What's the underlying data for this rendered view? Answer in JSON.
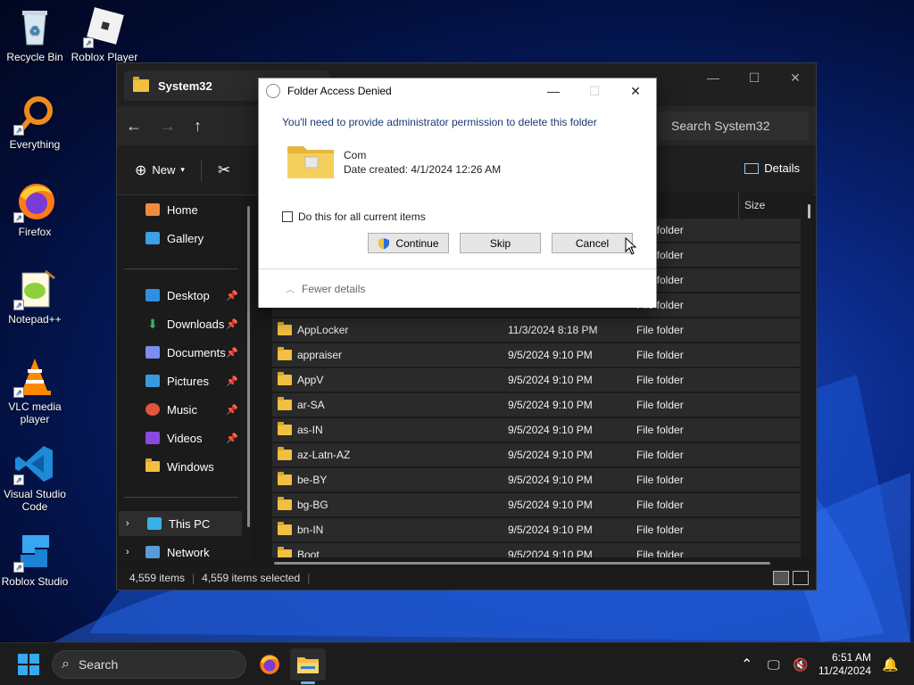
{
  "desktop": {
    "icons": [
      {
        "label": "Recycle Bin",
        "icon": "recycle-bin-icon"
      },
      {
        "label": "Roblox Player",
        "icon": "roblox-icon"
      },
      {
        "label": "Everything",
        "icon": "everything-search-icon"
      },
      {
        "label": "Firefox",
        "icon": "firefox-icon"
      },
      {
        "label": "Notepad++",
        "icon": "notepad-plus-plus-icon"
      },
      {
        "label": "VLC media player",
        "icon": "vlc-icon"
      },
      {
        "label": "Visual Studio Code",
        "icon": "vscode-icon"
      },
      {
        "label": "Roblox Studio",
        "icon": "roblox-studio-icon"
      }
    ]
  },
  "explorer": {
    "tab_title": "System32",
    "search_placeholder": "Search System32",
    "toolbar": {
      "new_label": "New",
      "details_label": "Details"
    },
    "sidebar": {
      "top": [
        {
          "label": "Home"
        },
        {
          "label": "Gallery"
        }
      ],
      "quick": [
        {
          "label": "Desktop"
        },
        {
          "label": "Downloads"
        },
        {
          "label": "Documents"
        },
        {
          "label": "Pictures"
        },
        {
          "label": "Music"
        },
        {
          "label": "Videos"
        },
        {
          "label": "Windows"
        }
      ],
      "bottom": [
        {
          "label": "This PC"
        },
        {
          "label": "Network"
        }
      ]
    },
    "columns": {
      "size": "Size"
    },
    "hidden_rows_type": "File folder",
    "rows": [
      {
        "name": "AppLocker",
        "date": "11/3/2024 8:18 PM",
        "type": "File folder"
      },
      {
        "name": "appraiser",
        "date": "9/5/2024 9:10 PM",
        "type": "File folder"
      },
      {
        "name": "AppV",
        "date": "9/5/2024 9:10 PM",
        "type": "File folder"
      },
      {
        "name": "ar-SA",
        "date": "9/5/2024 9:10 PM",
        "type": "File folder"
      },
      {
        "name": "as-IN",
        "date": "9/5/2024 9:10 PM",
        "type": "File folder"
      },
      {
        "name": "az-Latn-AZ",
        "date": "9/5/2024 9:10 PM",
        "type": "File folder"
      },
      {
        "name": "be-BY",
        "date": "9/5/2024 9:10 PM",
        "type": "File folder"
      },
      {
        "name": "bg-BG",
        "date": "9/5/2024 9:10 PM",
        "type": "File folder"
      },
      {
        "name": "bn-IN",
        "date": "9/5/2024 9:10 PM",
        "type": "File folder"
      },
      {
        "name": "Boot",
        "date": "9/5/2024 9:10 PM",
        "type": "File folder"
      }
    ],
    "status": {
      "items": "4,559 items",
      "selected": "4,559 items selected"
    }
  },
  "dialog": {
    "title": "Folder Access Denied",
    "message": "You'll need to provide administrator permission to delete this folder",
    "folder_name": "Com",
    "folder_date": "Date created: 4/1/2024 12:26 AM",
    "checkbox_label": "Do this for all current items",
    "buttons": {
      "continue": "Continue",
      "skip": "Skip",
      "cancel": "Cancel"
    },
    "fewer_details": "Fewer details"
  },
  "taskbar": {
    "search_label": "Search",
    "time": "6:51 AM",
    "date": "11/24/2024"
  }
}
